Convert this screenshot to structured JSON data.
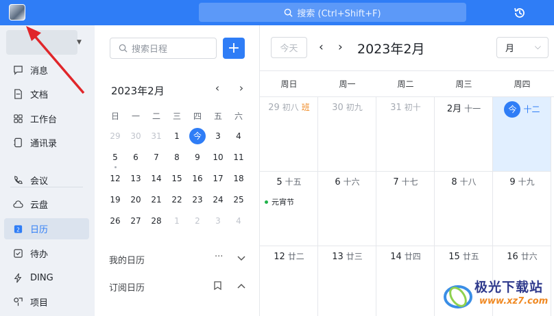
{
  "topbar": {
    "search_placeholder": "搜索 (Ctrl+Shift+F)"
  },
  "nav": {
    "items": [
      {
        "label": "消息",
        "icon": "message-icon"
      },
      {
        "label": "文档",
        "icon": "document-icon"
      },
      {
        "label": "工作台",
        "icon": "grid-icon"
      },
      {
        "label": "通讯录",
        "icon": "contacts-icon"
      },
      {
        "label": "会议",
        "icon": "phone-icon"
      },
      {
        "label": "云盘",
        "icon": "cloud-icon"
      },
      {
        "label": "日历",
        "icon": "calendar-icon",
        "active": true
      },
      {
        "label": "待办",
        "icon": "todo-icon"
      },
      {
        "label": "DING",
        "icon": "ding-icon"
      },
      {
        "label": "项目",
        "icon": "project-icon"
      }
    ]
  },
  "mini": {
    "search_placeholder": "搜索日程",
    "add_label": "+",
    "title": "2023年2月",
    "weekdays": [
      "日",
      "一",
      "二",
      "三",
      "四",
      "五",
      "六"
    ],
    "weeks": [
      [
        "29",
        "30",
        "31",
        "1",
        "今",
        "3",
        "4"
      ],
      [
        "5",
        "6",
        "7",
        "8",
        "9",
        "10",
        "11"
      ],
      [
        "12",
        "13",
        "14",
        "15",
        "16",
        "17",
        "18"
      ],
      [
        "19",
        "20",
        "21",
        "22",
        "23",
        "24",
        "25"
      ],
      [
        "26",
        "27",
        "28",
        "1",
        "2",
        "3",
        "4"
      ]
    ],
    "my_calendar": "我的日历",
    "subscribed_calendar": "订阅日历",
    "more": "···"
  },
  "main": {
    "today_label": "今天",
    "title": "2023年2月",
    "view_label": "月",
    "weekdays": [
      "周日",
      "周一",
      "周二",
      "周三",
      "周四"
    ],
    "rows": [
      [
        {
          "n": "29",
          "l": "初八",
          "ban": "班",
          "dim": true
        },
        {
          "n": "30",
          "l": "初九",
          "dim": true
        },
        {
          "n": "31",
          "l": "初十",
          "dim": true
        },
        {
          "n": "2月",
          "l": "十一"
        },
        {
          "n": "今",
          "l": "十二",
          "today": true
        }
      ],
      [
        {
          "n": "5",
          "l": "十五",
          "event": "元宵节"
        },
        {
          "n": "6",
          "l": "十六"
        },
        {
          "n": "7",
          "l": "十七"
        },
        {
          "n": "8",
          "l": "十八"
        },
        {
          "n": "9",
          "l": "十九"
        }
      ],
      [
        {
          "n": "12",
          "l": "廿二"
        },
        {
          "n": "13",
          "l": "廿三"
        },
        {
          "n": "14",
          "l": "廿四"
        },
        {
          "n": "15",
          "l": "廿五"
        },
        {
          "n": "16",
          "l": "廿六"
        }
      ]
    ]
  },
  "watermark": {
    "title": "极光下载站",
    "url": "www.xz7.com"
  },
  "colors": {
    "accent": "#2f7df6",
    "annotation_arrow": "#e0262a",
    "event_dot": "#20b24a",
    "holiday": "#f08a24"
  }
}
